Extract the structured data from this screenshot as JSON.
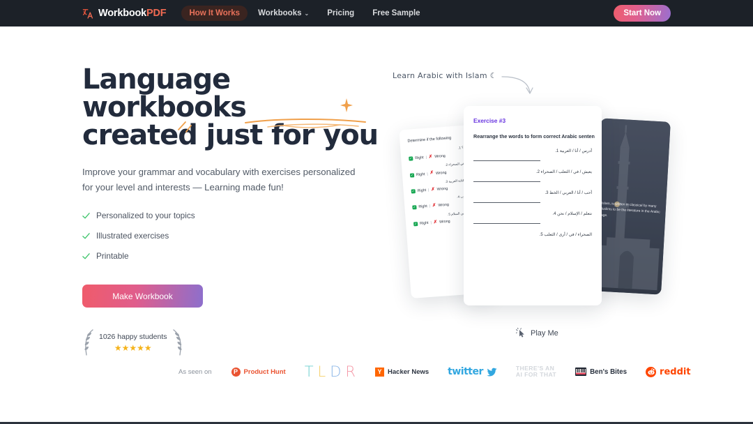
{
  "nav": {
    "brand": {
      "text_main": "Workbook",
      "text_accent": "PDF",
      "icon": "translate-icon"
    },
    "links": [
      {
        "label": "How It Works",
        "active": true
      },
      {
        "label": "Workbooks",
        "caret": "⌄",
        "active": false
      },
      {
        "label": "Pricing",
        "active": false
      },
      {
        "label": "Free Sample",
        "active": false
      }
    ],
    "cta": {
      "label": "Start Now"
    }
  },
  "hero": {
    "headline_line1": "Language workbooks",
    "headline_line2": "created just for you",
    "subtext": "Improve your grammar and vocabulary with exercises personalized for your level and interests — Learning made fun!",
    "features": [
      {
        "label": "Personalized to your topics",
        "icon": "check-icon"
      },
      {
        "label": "Illustrated exercises",
        "icon": "check-icon"
      },
      {
        "label": "Printable",
        "icon": "check-icon"
      }
    ],
    "cta": {
      "label": "Make Workbook"
    },
    "social_proof": {
      "count_text": "1026 happy students",
      "stars": "★★★★★",
      "star_color": "#f5b31b"
    },
    "annotation": {
      "text": "Learn Arabic with Islam ☾",
      "arrow": "curved-arrow-icon"
    }
  },
  "cards": {
    "worksheet": {
      "title": "Determine if the following",
      "items": [
        {
          "num": "1.",
          "arabic": "ما اسمك؟",
          "right": "Right",
          "wrong": "Wrong"
        },
        {
          "num": "2.",
          "arabic": "الصحراء في الصحراء",
          "right": "Right",
          "wrong": "Wrong"
        },
        {
          "num": "3.",
          "arabic": "أنا ألعب الكتابة العربية",
          "right": "Right",
          "wrong": "Wrong"
        },
        {
          "num": "4.",
          "arabic": "أنا الماء شرب",
          "right": "Right",
          "wrong": "Wrong"
        },
        {
          "num": "5.",
          "arabic": "الإسلام هو دين السلام",
          "right": "Right",
          "wrong": "Wrong"
        }
      ],
      "separator": "|"
    },
    "exercise": {
      "title": "Exercise #3",
      "instruction": "Rearrange the words to form correct Arabic senten",
      "items": [
        {
          "num": "1.",
          "words": "أدرس  /  أنا  /  العربية"
        },
        {
          "num": "2.",
          "words": "يعيش  /  في  /  الثعلب  /  الصحراء"
        },
        {
          "num": "3.",
          "words": "أحب  /  أنا  /  العربي  /  الخط"
        },
        {
          "num": "4.",
          "words": "نتعلم  /  الإسلام  /  نحن"
        },
        {
          "num": "5.",
          "words": "الصحراء  /  في  /  أرى  /  الثعلب"
        }
      ]
    },
    "photo": {
      "caption": "f Islam, is written in classical by many Muslims to be the literature in the Arabic uage.",
      "image": "mosque-minaret-photo"
    }
  },
  "play": {
    "label": "Play Me",
    "icon": "cursor-click-icon"
  },
  "as_seen_on": {
    "label": "As seen on",
    "logos": [
      {
        "name": "Product Hunt",
        "mark": "P",
        "color": "#ea5331"
      },
      {
        "name": "TLDR",
        "letters": [
          "T",
          "L",
          "D",
          "R"
        ]
      },
      {
        "name": "Hacker News",
        "mark": "Y",
        "color": "#ff6600"
      },
      {
        "name": "twitter",
        "color": "#32a7e0"
      },
      {
        "name": "THERE'S AN AI FOR THAT",
        "line1": "THERE'S AN",
        "line2": "AI FOR THAT",
        "color": "#d3d7dc"
      },
      {
        "name": "Ben's Bites",
        "color": "#2b3340"
      },
      {
        "name": "reddit",
        "color": "#ff4500"
      }
    ]
  },
  "theme": {
    "nav_bg": "#1c2128",
    "accent_red": "#ef6a52",
    "headline": "#222b3c",
    "orange": "#f0a04b",
    "purple": "#6834e0",
    "green": "#19a854"
  }
}
